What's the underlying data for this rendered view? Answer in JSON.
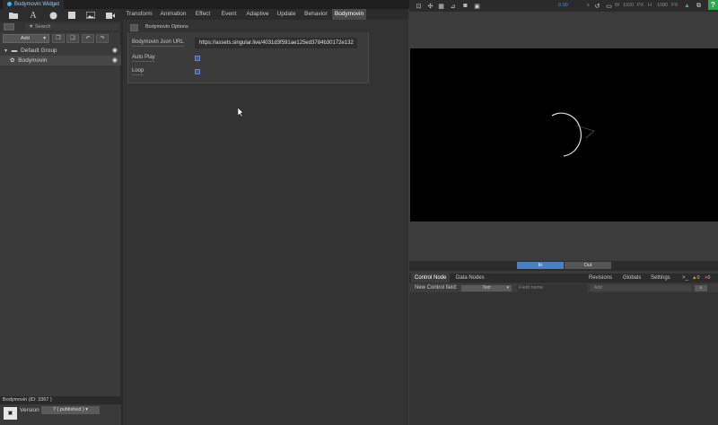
{
  "window": {
    "title": "Bodymovin Widget"
  },
  "toolbar_left": {
    "icons": [
      "folder-icon",
      "text-icon",
      "circle-icon",
      "square-icon",
      "image-icon",
      "video-icon"
    ]
  },
  "tabs": [
    "Transform",
    "Animation",
    "Effect",
    "Event",
    "Adaptive",
    "Update",
    "Behavior",
    "Bodymovin"
  ],
  "active_tab": "Bodymovin",
  "left": {
    "search_placeholder": "Search",
    "add_label": "Add",
    "tree": {
      "group_label": "Default Group",
      "item_label": "Bodymovin"
    },
    "info": "Bodymovin (ID: 3367 )",
    "version_label": "Version",
    "version_value": "7 ( published )"
  },
  "options": {
    "title": "Bodymovin Options",
    "fields": {
      "json_url_label": "Bodymovin Json URL",
      "json_url_value": "https://assets.singular.live/4031d3f591ae125ed3784b30172e132",
      "autoplay_label": "Auto Play",
      "loop_label": "Loop"
    }
  },
  "right_bar": {
    "time": "0.00",
    "time_unit": "s",
    "w_label": "W",
    "w_value": "1920",
    "w_unit": "PX",
    "h_label": "H",
    "h_value": "1080",
    "h_unit": "PX",
    "help": "?"
  },
  "preview": {
    "in_label": "In",
    "out_label": "Out"
  },
  "control_node": {
    "tabs": [
      "Control Node",
      "Data Nodes"
    ],
    "right_tabs": [
      "Revisions",
      "Globals",
      "Settings"
    ],
    "console": ">_",
    "warnings": "0",
    "errors": "0",
    "new_field_label": "New Control field:",
    "type_value": "Text",
    "field_name_placeholder": "Field name",
    "add_label": "Add"
  },
  "colors": {
    "accent": "#4a7fc1",
    "help_green": "#2fa84f",
    "warning": "#e8a020",
    "error": "#e04040"
  }
}
